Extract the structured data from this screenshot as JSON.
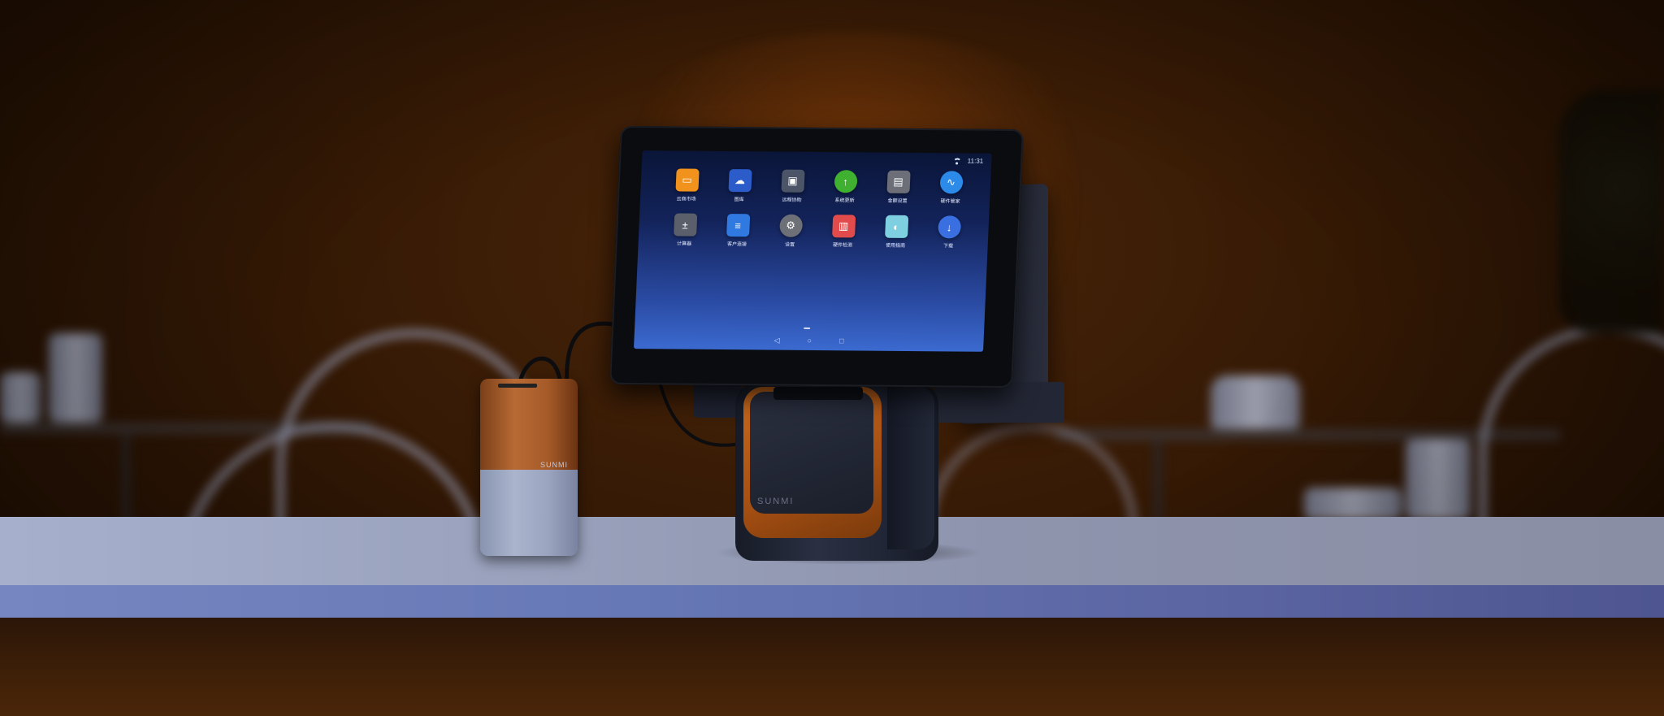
{
  "scene": {
    "description_colors": {
      "wall": "#3a1c06",
      "counter": "#9aa2bd",
      "counter_edge": "#6677b6",
      "accent_orange": "#c86a1e"
    }
  },
  "powerbank": {
    "brand": "SUNMI"
  },
  "device": {
    "brand": "SUNMI",
    "status_bar": {
      "wifi_icon": "wifi-icon",
      "time": "11:31"
    },
    "apps": [
      {
        "label": "云商市场",
        "icon": "shopping-bag-icon",
        "glyph": "▭",
        "color": "#f0921c",
        "round": false
      },
      {
        "label": "图库",
        "icon": "gallery-icon",
        "glyph": "☁",
        "color": "#2b5cc9",
        "round": false
      },
      {
        "label": "远程协助",
        "icon": "monitor-icon",
        "glyph": "▣",
        "color": "#4c5468",
        "round": false
      },
      {
        "label": "系统更新",
        "icon": "update-arrow-icon",
        "glyph": "↑",
        "color": "#3fb02f",
        "round": true
      },
      {
        "label": "金额设置",
        "icon": "settings-panel-icon",
        "glyph": "▤",
        "color": "#6c6f78",
        "round": false
      },
      {
        "label": "硬件管家",
        "icon": "pulse-icon",
        "glyph": "∿",
        "color": "#2c8ae8",
        "round": true
      },
      {
        "label": "计算器",
        "icon": "calculator-icon",
        "glyph": "±",
        "color": "#5a5f6b",
        "round": false
      },
      {
        "label": "客户连接",
        "icon": "contact-card-icon",
        "glyph": "≡",
        "color": "#2f79e0",
        "round": false
      },
      {
        "label": "设置",
        "icon": "gear-icon",
        "glyph": "⚙",
        "color": "#6e7078",
        "round": true
      },
      {
        "label": "硬件检测",
        "icon": "calendar-icon",
        "glyph": "▥",
        "color": "#e24b4b",
        "round": false
      },
      {
        "label": "使用指南",
        "icon": "map-guide-icon",
        "glyph": "◐",
        "color": "#7ed0e0",
        "round": false
      },
      {
        "label": "下载",
        "icon": "download-icon",
        "glyph": "↓",
        "color": "#3a6fe2",
        "round": true
      }
    ],
    "nav": {
      "back": "◁",
      "home": "○",
      "recents": "□"
    }
  }
}
